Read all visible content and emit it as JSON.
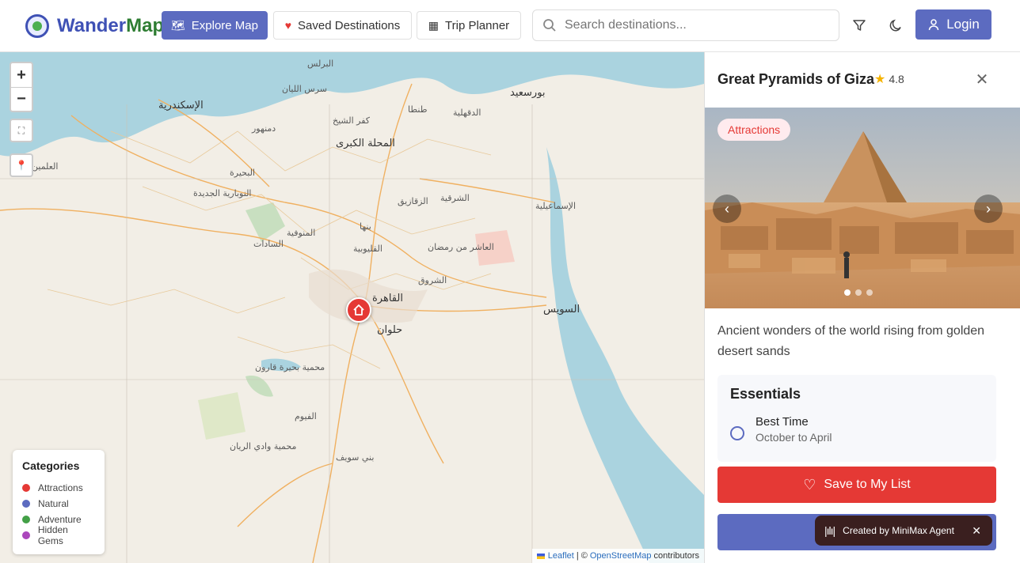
{
  "brand": {
    "name_part1": "Wander",
    "name_part2": "Map"
  },
  "nav": {
    "explore": {
      "icon": "map-icon",
      "label": "Explore Map"
    },
    "saved": {
      "icon": "heart-icon",
      "label": "Saved Destinations"
    },
    "planner": {
      "icon": "calendar-icon",
      "label": "Trip Planner"
    }
  },
  "search": {
    "placeholder": "Search destinations..."
  },
  "header_actions": {
    "filter_icon": "filter-icon",
    "theme_icon": "moon-icon",
    "login_label": "Login",
    "login_icon": "user-icon"
  },
  "map": {
    "zoom_in": "+",
    "zoom_out": "−",
    "places": [
      {
        "name": "الإسكندرية",
        "major": true
      },
      {
        "name": "بورسعيد",
        "major": true
      },
      {
        "name": "المحلة الكبرى",
        "major": true
      },
      {
        "name": "القاهرة",
        "major": true
      },
      {
        "name": "حلوان",
        "major": true
      },
      {
        "name": "السويس",
        "major": true
      },
      {
        "name": "الزقازيق",
        "major": false
      },
      {
        "name": "دمنهور",
        "major": false
      },
      {
        "name": "طنطا",
        "major": false
      },
      {
        "name": "بنها",
        "major": false
      },
      {
        "name": "الشرقية",
        "major": false
      },
      {
        "name": "الدقهلية",
        "major": false
      },
      {
        "name": "البحيرة",
        "major": false
      },
      {
        "name": "المنوفية",
        "major": false
      },
      {
        "name": "السادات",
        "major": false
      },
      {
        "name": "القليوبية",
        "major": false
      },
      {
        "name": "العاشر من رمضان",
        "major": false
      },
      {
        "name": "الشروق",
        "major": false
      },
      {
        "name": "الإسماعيلية",
        "major": false
      },
      {
        "name": "الفيوم",
        "major": false
      },
      {
        "name": "بني سويف",
        "major": false
      },
      {
        "name": "محمية وادي الريان",
        "major": false
      },
      {
        "name": "محمية بحيرة قارون",
        "major": false
      },
      {
        "name": "النوبارية الجديدة",
        "major": false
      },
      {
        "name": "البرلس",
        "major": false
      },
      {
        "name": "كفر الشيخ",
        "major": false
      },
      {
        "name": "سرس الليان",
        "major": false
      },
      {
        "name": "العلمين",
        "major": false
      }
    ],
    "marker_icon": "home-icon",
    "attribution": {
      "leaflet": "Leaflet",
      "separator": "| ©",
      "osm": "OpenStreetMap",
      "contributors": "contributors"
    }
  },
  "legend": {
    "title": "Categories",
    "items": [
      {
        "label": "Attractions",
        "color": "#e53935"
      },
      {
        "label": "Natural",
        "color": "#5c6bc0"
      },
      {
        "label": "Adventure",
        "color": "#43a047"
      },
      {
        "label": "Hidden Gems",
        "color": "#ab47bc"
      }
    ]
  },
  "panel": {
    "title": "Great Pyramids of Giza",
    "rating": "4.8",
    "tag": "Attractions",
    "description": "Ancient wonders of the world rising from golden desert sands",
    "essentials_title": "Essentials",
    "essentials": [
      {
        "key": "Best Time",
        "value": "October to April"
      }
    ],
    "save_label": "Save to My List",
    "slide_count": 3,
    "active_slide": 1
  },
  "toast": {
    "label": "Created by MiniMax Agent"
  },
  "colors": {
    "accent": "#5c6bc0",
    "danger": "#e53935",
    "brand_green": "#2e7d32"
  }
}
